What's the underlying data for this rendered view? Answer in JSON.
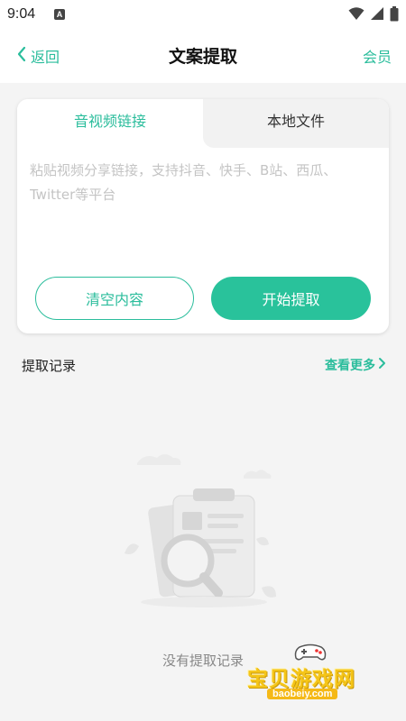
{
  "status_bar": {
    "time": "9:04",
    "notif_letter": "A"
  },
  "header": {
    "back_label": "返回",
    "title": "文案提取",
    "vip_label": "会员"
  },
  "tabs": [
    {
      "label": "音视频链接",
      "active": true
    },
    {
      "label": "本地文件",
      "active": false
    }
  ],
  "link_input": {
    "value": "",
    "placeholder": "粘贴视频分享链接，支持抖音、快手、B站、西瓜、Twitter等平台"
  },
  "buttons": {
    "clear_label": "清空内容",
    "start_label": "开始提取"
  },
  "history": {
    "title": "提取记录",
    "see_more_label": "查看更多",
    "empty_text": "没有提取记录"
  },
  "watermark": {
    "brand": "宝贝游戏网",
    "domain": "baobeiy.com"
  },
  "colors": {
    "accent": "#2bbd9c",
    "button_fill": "#29c29b",
    "page_bg": "#f4f4f4"
  },
  "icons": {
    "back": "chevron-left-icon",
    "see_more": "chevron-right-icon",
    "wifi": "wifi-icon",
    "signal": "signal-icon",
    "battery": "battery-icon",
    "empty": "clipboard-magnifier-icon"
  }
}
